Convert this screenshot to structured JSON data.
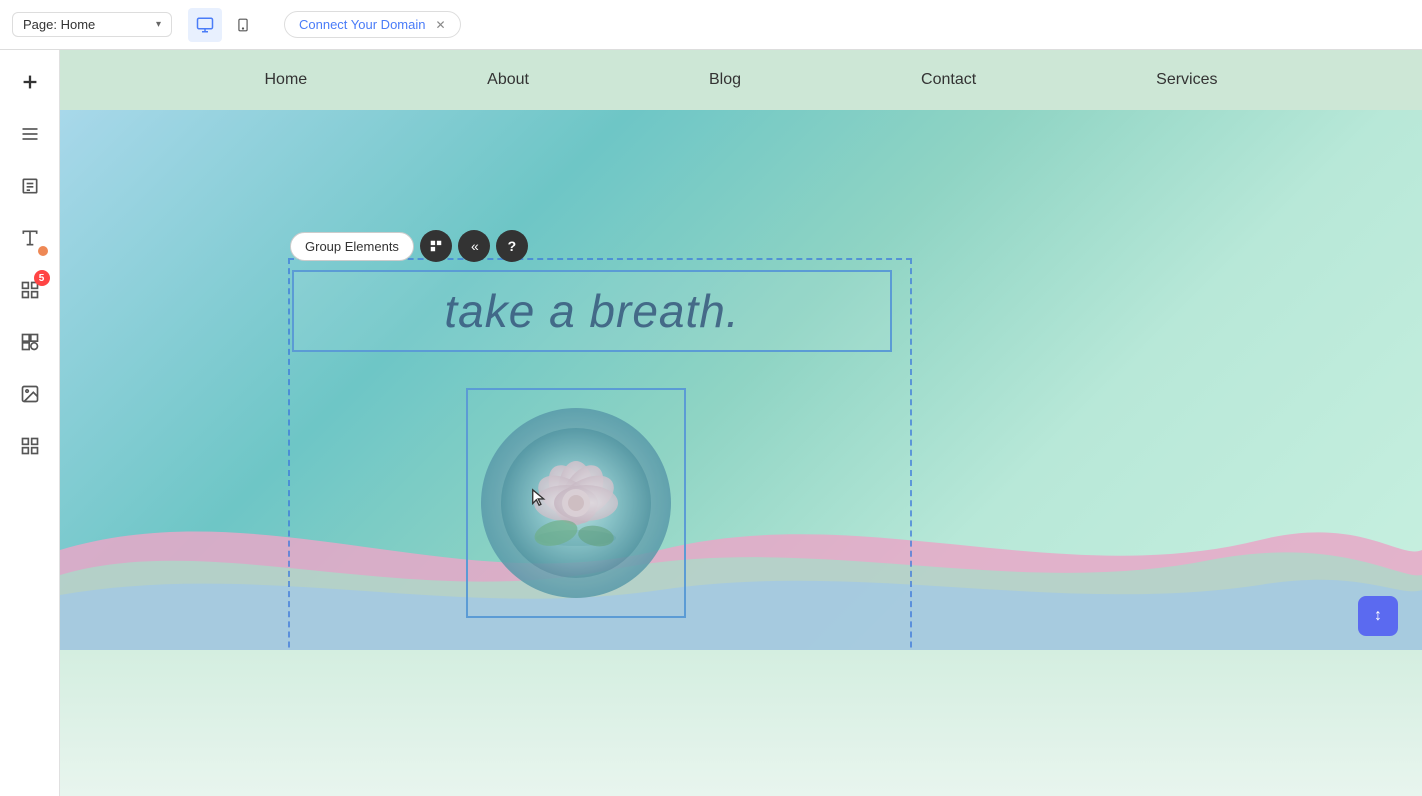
{
  "topbar": {
    "page_selector_label": "Page: Home",
    "domain_tab_label": "Connect Your Domain",
    "device_desktop_icon": "🖥",
    "device_mobile_icon": "📱"
  },
  "sidebar": {
    "icons": [
      {
        "name": "add-icon",
        "symbol": "+",
        "badge": null
      },
      {
        "name": "layers-icon",
        "symbol": "≡",
        "badge": null
      },
      {
        "name": "pages-icon",
        "symbol": "☰",
        "badge": null
      },
      {
        "name": "text-icon",
        "symbol": "A",
        "badge": null
      },
      {
        "name": "apps-icon",
        "symbol": "⊞",
        "badge": "5"
      },
      {
        "name": "elements-icon",
        "symbol": "⊕",
        "badge": null
      },
      {
        "name": "media-icon",
        "symbol": "🖼",
        "badge": null
      },
      {
        "name": "grid-icon",
        "symbol": "⊞",
        "badge": null
      }
    ]
  },
  "site_nav": {
    "items": [
      {
        "label": "Home"
      },
      {
        "label": "About"
      },
      {
        "label": "Blog"
      },
      {
        "label": "Contact"
      },
      {
        "label": "Services"
      }
    ]
  },
  "toolbar": {
    "group_elements_label": "Group Elements",
    "move_icon": "⊞",
    "back_icon": "«",
    "help_icon": "?"
  },
  "hero": {
    "heading": "take a breath."
  },
  "scroll_button": {
    "icon": "↕"
  }
}
